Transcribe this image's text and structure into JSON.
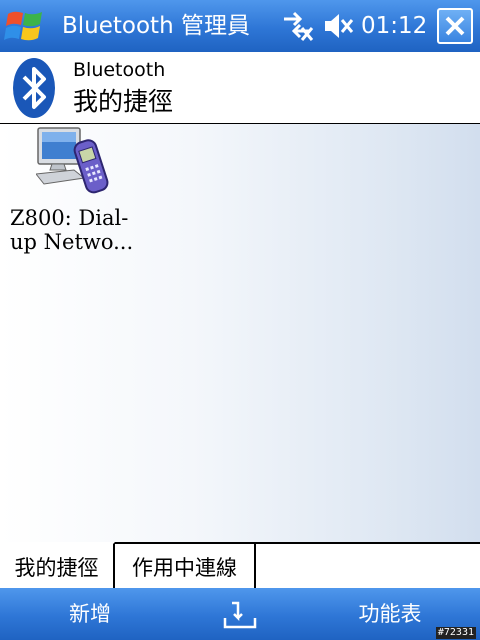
{
  "titlebar": {
    "title": "Bluetooth 管理員",
    "clock": "01:12"
  },
  "header": {
    "title": "Bluetooth",
    "subtitle": "我的捷徑"
  },
  "shortcuts": [
    {
      "label_line1": "Z800: Dial-",
      "label_line2": "up Netwo..."
    }
  ],
  "tabs": [
    {
      "label": "我的捷徑"
    },
    {
      "label": "作用中連線"
    }
  ],
  "softkeys": {
    "left": "新增",
    "right": "功能表"
  },
  "watermark": "#72331",
  "colors": {
    "bar_blue": "#2e76d6",
    "bt_blue": "#1a57b8"
  }
}
